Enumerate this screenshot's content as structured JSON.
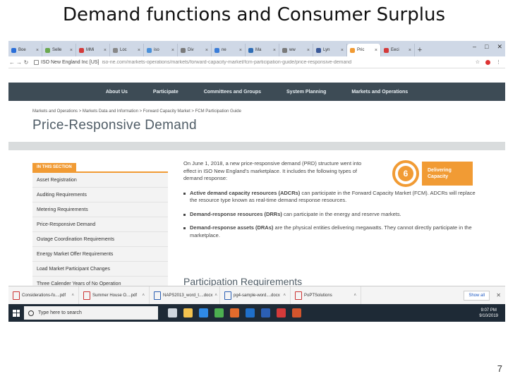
{
  "slide": {
    "title": "Demand functions and Consumer Surplus",
    "page_number": "7"
  },
  "browser": {
    "tabs": [
      {
        "label": "Boe",
        "color": "#2a6ed8"
      },
      {
        "label": "Selle",
        "color": "#6aa84f"
      },
      {
        "label": "MMi",
        "color": "#d33a3a"
      },
      {
        "label": "Loc",
        "color": "#888888"
      },
      {
        "label": "iso",
        "color": "#4a90d9"
      },
      {
        "label": "Div",
        "color": "#7a7a7a"
      },
      {
        "label": "ne",
        "color": "#3b7dd8"
      },
      {
        "label": "Ma",
        "color": "#2f6db5"
      },
      {
        "label": "ww",
        "color": "#7a7a7a"
      },
      {
        "label": "Lyn",
        "color": "#3b5998"
      },
      {
        "label": "Pric",
        "color": "#f19b34",
        "active": true
      },
      {
        "label": "Eeci",
        "color": "#d33a3a"
      }
    ],
    "url_org": "ISO New England Inc [US]",
    "url_path": "iso-ne.com/markets-operations/markets/forward-capacity-market/fcm-participation-guide/price-responsive-demand"
  },
  "site": {
    "nav": [
      "About Us",
      "Participate",
      "Committees and Groups",
      "System Planning",
      "Markets and Operations"
    ],
    "breadcrumb": "Markets and Operations  >  Markets Data and Information  >  Forward Capacity Market  >  FCM Participation Guide",
    "page_heading": "Price-Responsive Demand",
    "section_tag": "IN THIS SECTION",
    "sidebar_items": [
      "Asset Registration",
      "Auditing Requirements",
      "Metering Requirements",
      "Price-Responsive Demand",
      "Outage Coordination Requirements",
      "Energy Market Offer Requirements",
      "Load Market Participant Changes",
      "Three Calender Years of No Operation"
    ],
    "intro": "On June 1, 2018, a new price-responsive demand (PRD) structure went into effect in ISO New England's marketplace. It includes the following types of demand response:",
    "capacity_number": "6",
    "capacity_label": "Delivering Capacity",
    "bullets": [
      {
        "term": "Active demand capacity resources (ADCRs)",
        "text": " can participate in the Forward Capacity Market (FCM). ADCRs will replace the resource type known as real-time demand response resources."
      },
      {
        "term": "Demand-response resources (DRRs)",
        "text": " can participate in the energy and reserve markets."
      },
      {
        "term": "Demand-response assets (DRAs)",
        "text": " are the physical entities delivering megawatts. They cannot directly participate in the marketplace."
      }
    ],
    "subheading": "Participation Requirements"
  },
  "downloads": {
    "items": [
      {
        "name": "Considerations-fo....pdf",
        "type": "pdf"
      },
      {
        "name": "Summer House O....pdf",
        "type": "pdf"
      },
      {
        "name": "NAPS2013_word_t....docx",
        "type": "word"
      },
      {
        "name": "pg4-sample-word....docx",
        "type": "word"
      },
      {
        "name": "PoPTSolutions",
        "type": "pdf"
      }
    ],
    "show_all": "Show all"
  },
  "taskbar": {
    "search_placeholder": "Type here to search",
    "icons": [
      {
        "name": "task-view-icon",
        "color": "#cfd6de"
      },
      {
        "name": "file-explorer-icon",
        "color": "#f2c14e"
      },
      {
        "name": "edge-icon",
        "color": "#2f8ae6"
      },
      {
        "name": "chrome-icon",
        "color": "#4caf50"
      },
      {
        "name": "matlab-icon",
        "color": "#e36b2c"
      },
      {
        "name": "outlook-icon",
        "color": "#1f6fc9"
      },
      {
        "name": "word-icon",
        "color": "#2b5fb4"
      },
      {
        "name": "acrobat-icon",
        "color": "#d33a3a"
      },
      {
        "name": "powerpoint-icon",
        "color": "#d2552d"
      }
    ],
    "time": "9:07 PM",
    "date": "9/10/2019"
  }
}
